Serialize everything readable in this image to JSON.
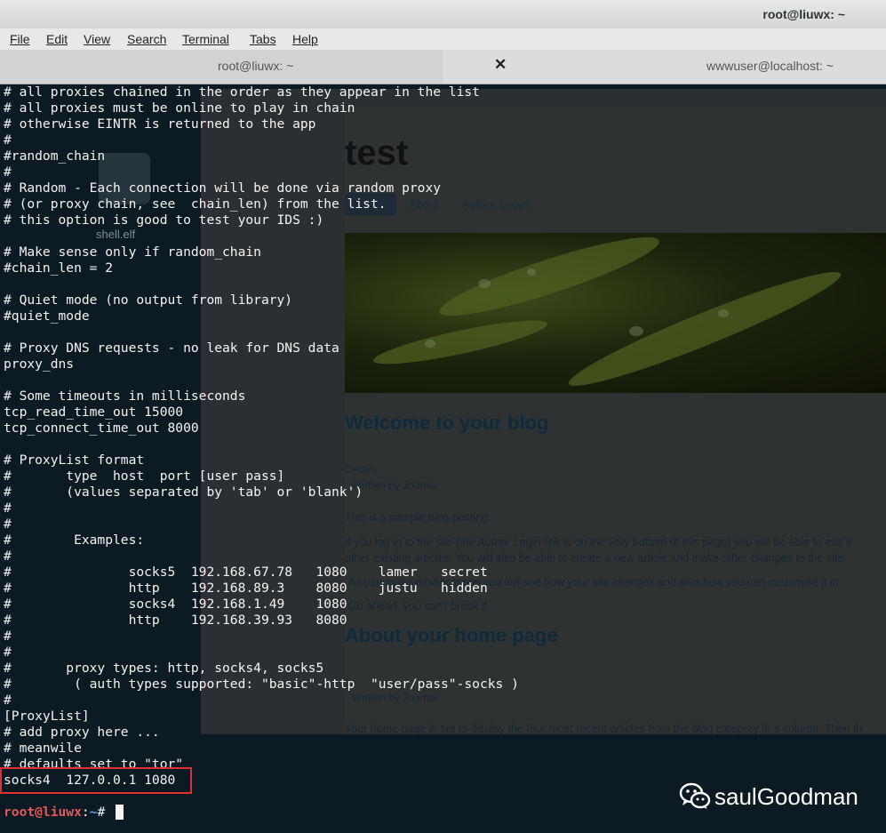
{
  "window": {
    "title": "root@liuwx: ~"
  },
  "menu": [
    "File",
    "Edit",
    "View",
    "Search",
    "Terminal",
    "Tabs",
    "Help"
  ],
  "tabs": [
    {
      "label": "root@liuwx: ~",
      "active": false
    },
    {
      "label": "wwwuser@localhost: ~",
      "active": true
    }
  ],
  "desktop": {
    "icon_label": "shell.elf"
  },
  "browser": {
    "site_title": "test",
    "nav": [
      "Home",
      "About",
      "Author Login"
    ],
    "heading1": "Welcome to your blog",
    "details": "Details",
    "written_by": "Written by Joomla",
    "para1": "This is a sample blog posting.",
    "para2a": "If you log in to the site (the Author Login link is on the very bottom of this page) you will be able to edit it",
    "para2b": "other existing articles. You will also be able to create a new article and make other changes to the site.",
    "para3a": "As you make modifications you will see how your site changes and also how you can customise it in",
    "para3b": "Go ahead, you can't break it.",
    "heading2": "About your home page",
    "written_by2": "Written by Joomla",
    "para4": "Your home page is set to display the four most recent articles from the blog category in a column. Then th"
  },
  "terminal": {
    "lines": [
      "# all proxies chained in the order as they appear in the list",
      "# all proxies must be online to play in chain",
      "# otherwise EINTR is returned to the app",
      "#",
      "#random_chain",
      "#",
      "# Random - Each connection will be done via random proxy",
      "# (or proxy chain, see  chain_len) from the list.",
      "# this option is good to test your IDS :)",
      "",
      "# Make sense only if random_chain",
      "#chain_len = 2",
      "",
      "# Quiet mode (no output from library)",
      "#quiet_mode",
      "",
      "# Proxy DNS requests - no leak for DNS data",
      "proxy_dns",
      "",
      "# Some timeouts in milliseconds",
      "tcp_read_time_out 15000",
      "tcp_connect_time_out 8000",
      "",
      "# ProxyList format",
      "#       type  host  port [user pass]",
      "#       (values separated by 'tab' or 'blank')",
      "#",
      "#",
      "#        Examples:",
      "#",
      "#               socks5  192.168.67.78   1080    lamer   secret",
      "#               http    192.168.89.3    8080    justu   hidden",
      "#               socks4  192.168.1.49    1080",
      "#               http    192.168.39.93   8080",
      "#",
      "#",
      "#       proxy types: http, socks4, socks5",
      "#        ( auth types supported: \"basic\"-http  \"user/pass\"-socks )",
      "#",
      "[ProxyList]",
      "# add proxy here ...",
      "# meanwile",
      "# defaults set to \"tor\""
    ],
    "highlighted_line": "socks4  127.0.0.1 1080",
    "prompt": {
      "user_host": "root@liuwx",
      "separator": ":",
      "path": "~",
      "symbol": "# "
    }
  },
  "watermark": {
    "text": "saulGoodman",
    "icon": "wechat-icon"
  },
  "colors": {
    "terminal_bg": "#0c1a23",
    "terminal_fg": "#f4f4f4",
    "highlight_border": "#e03030",
    "prompt_user": "#e35a5a",
    "prompt_path": "#5da0e8"
  }
}
